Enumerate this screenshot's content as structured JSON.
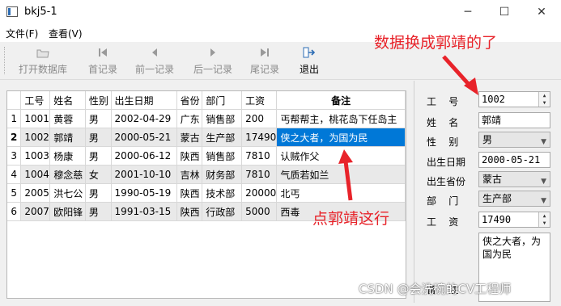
{
  "window": {
    "title": "bkj5-1",
    "minimize_glyph": "─",
    "maximize_glyph": "☐",
    "close_glyph": "✕"
  },
  "menu": [
    "文件(F)",
    "查看(V)"
  ],
  "toolbar": {
    "open_db": "打开数据库",
    "first": "首记录",
    "prev": "前一记录",
    "next": "后一记录",
    "last": "尾记录",
    "exit": "退出"
  },
  "table": {
    "headers": [
      "工号",
      "姓名",
      "性别",
      "出生日期",
      "省份",
      "部门",
      "工资",
      "备注"
    ],
    "row_numbers": [
      "1",
      "2",
      "3",
      "4",
      "5",
      "6"
    ],
    "rows": [
      [
        "1001",
        "黄蓉",
        "男",
        "2002-04-29",
        "广东",
        "销售部",
        "200",
        "丐帮帮主，桃花岛下任岛主"
      ],
      [
        "1002",
        "郭靖",
        "男",
        "2000-05-21",
        "蒙古",
        "生产部",
        "17490",
        "侠之大者，为国为民"
      ],
      [
        "1003",
        "杨康",
        "男",
        "2000-06-12",
        "陕西",
        "销售部",
        "7810",
        "认贼作父"
      ],
      [
        "1004",
        "穆念慈",
        "女",
        "2001-10-10",
        "吉林",
        "财务部",
        "7810",
        "气质若如兰"
      ],
      [
        "2005",
        "洪七公",
        "男",
        "1990-05-19",
        "陕西",
        "技术部",
        "20000",
        "北丐"
      ],
      [
        "2007",
        "欧阳锋",
        "男",
        "1991-03-15",
        "陕西",
        "行政部",
        "5000",
        "西毒"
      ]
    ],
    "current_row": 2,
    "selected_column": "备注"
  },
  "form": {
    "labels": {
      "id": "工    号",
      "name": "姓    名",
      "gender": "性    别",
      "birth": "出生日期",
      "province": "出生省份",
      "dept": "部    门",
      "salary": "工    资",
      "remark": "备    注"
    },
    "id_value": "1002",
    "name_value": "郭靖",
    "gender_value": "男",
    "birth_value": "2000-05-21",
    "province_value": "蒙古",
    "dept_value": "生产部",
    "salary_value": "17490",
    "remark_value": "侠之大者，为国为民"
  },
  "annotations": {
    "top": "数据换成郭靖的了",
    "middle": "点郭靖这行"
  },
  "watermark": "CSDN @会洗碗的CV工程师",
  "colors": {
    "selection": "#0078d7",
    "annotation": "#e8232a"
  }
}
